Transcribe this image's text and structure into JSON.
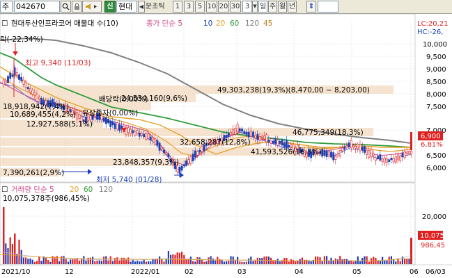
{
  "toolbar": {
    "market": "주",
    "code": "042670",
    "search_icon": "search-icon",
    "lock_icon": "padlock-icon",
    "sound_icon": "speaker-icon",
    "new_label": "신",
    "name_short": "현대",
    "period_prefix": "분초틱",
    "intervals": [
      "1",
      "3",
      "5",
      "10",
      "20",
      "30"
    ],
    "interval_selected": "3",
    "day_label": "일",
    "week_label": "주",
    "month_label": "월",
    "year_label": "년",
    "updown_icon": "up-down-arrows-icon"
  },
  "legend": {
    "stock_name": "현대두산인프라코어 매물대 수(10)",
    "price_label": "종가 단순 5",
    "ma": [
      "10",
      "20",
      "60",
      "120",
      "45"
    ],
    "lc": "LC:20,21",
    "hc": "HC:-26,"
  },
  "colors": {
    "up": "#e02020",
    "down": "#1c3fb5",
    "ma5": "#6b6bd6",
    "ma10": "#d44a8c",
    "ma20": "#e7a12a",
    "ma60": "#2f9c3a",
    "ma120": "#777777",
    "volume_profile": "#f3dcc4"
  },
  "annotations": {
    "top_left": "락(-22,34%)",
    "high": "최고 9,340 (11/03)",
    "low": "최저 5,740 (01/28)",
    "dividend": "배당락(0,00%)",
    "rights": "유상증자(0,00%)"
  },
  "volume_profile": [
    {
      "label": "49,303,238(19,3%)(8,470,00 ~ 8,203,00)",
      "value": 49303238
    },
    {
      "label": "24,534,160(9,6%)",
      "value": 24534160
    },
    {
      "label": "18,918,942(7,4%)",
      "value": 18918942
    },
    {
      "label": "10,689,455(4,2%)",
      "value": 10689455
    },
    {
      "label": "12,927,588(5,1%)",
      "value": 12927588
    },
    {
      "label": "46,775,349(18,3%)",
      "value": 46775349
    },
    {
      "label": "32,658,287(12,8%)",
      "value": 32658287
    },
    {
      "label": "41,593,526(16,3%)",
      "value": 41593526
    },
    {
      "label": "23,848,357(9,3%)",
      "value": 23848357
    },
    {
      "label": "7,390,261(2,9%)",
      "value": 7390261
    }
  ],
  "price_axis": [
    "10,000",
    "9,500",
    "9,000",
    "8,500",
    "8,000",
    "7,500",
    "7,000",
    "6,500",
    "6,000"
  ],
  "price_current": "6,900",
  "price_change": "6,81%",
  "volume_legend": {
    "label": "거래량 단순 5",
    "ma": [
      "20",
      "60",
      "120"
    ],
    "value": "10,075,378주(986,45%)"
  },
  "volume_axis": [
    "20,000"
  ],
  "volume_current": "10,075",
  "volume_pct": "986,45",
  "date_axis": [
    "2021/10",
    "12",
    "2022/01",
    "02",
    "03",
    "04",
    "05",
    "06",
    "06/03"
  ]
}
